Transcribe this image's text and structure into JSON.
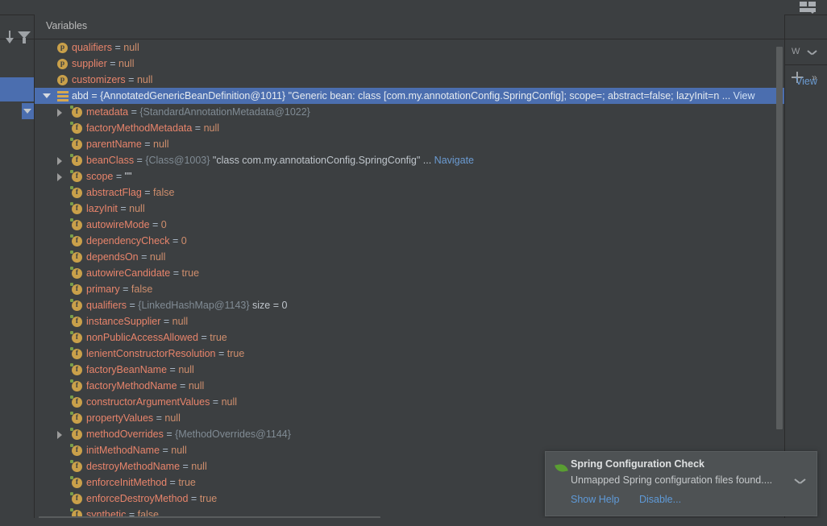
{
  "window": {
    "layout_icon": "window-layout-icon"
  },
  "toolbar_left": {
    "sort_icon": "sort-descending-icon",
    "filter_icon": "filter-funnel-icon"
  },
  "panel": {
    "title": "Variables"
  },
  "right_rail": {
    "watch_icon": "watch-variable-icon",
    "expand_icon": "chevron-down-icon",
    "add_icon": "plus-icon",
    "more_icon": "»",
    "view_label": "View"
  },
  "tree": {
    "rows": [
      {
        "indent": 0,
        "twisty": "none",
        "icon": "p",
        "name": "qualifiers",
        "eq": " = ",
        "value": "null",
        "value_kind": "null",
        "extra": "",
        "link": "",
        "selected": false
      },
      {
        "indent": 0,
        "twisty": "none",
        "icon": "p",
        "name": "supplier",
        "eq": " = ",
        "value": "null",
        "value_kind": "null",
        "extra": "",
        "link": "",
        "selected": false
      },
      {
        "indent": 0,
        "twisty": "none",
        "icon": "p",
        "name": "customizers",
        "eq": " = ",
        "value": "null",
        "value_kind": "null",
        "extra": "",
        "link": "",
        "selected": false
      },
      {
        "indent": 0,
        "twisty": "open",
        "icon": "stack",
        "name": "abd",
        "eq": " = ",
        "value": "{AnnotatedGenericBeanDefinition@1011}",
        "value_kind": "ref",
        "extra": " \"Generic bean: class [com.my.annotationConfig.SpringConfig]; scope=; abstract=false; lazyInit=n ...",
        "link": "View",
        "selected": true
      },
      {
        "indent": 1,
        "twisty": "closed",
        "icon": "f",
        "name": "metadata",
        "eq": " = ",
        "value": "{StandardAnnotationMetadata@1022}",
        "value_kind": "ref",
        "extra": "",
        "link": "",
        "selected": false
      },
      {
        "indent": 1,
        "twisty": "none",
        "icon": "f",
        "name": "factoryMethodMetadata",
        "eq": " = ",
        "value": "null",
        "value_kind": "null",
        "extra": "",
        "link": "",
        "selected": false
      },
      {
        "indent": 1,
        "twisty": "none",
        "icon": "f",
        "name": "parentName",
        "eq": " = ",
        "value": "null",
        "value_kind": "null",
        "extra": "",
        "link": "",
        "selected": false
      },
      {
        "indent": 1,
        "twisty": "closed",
        "icon": "f",
        "name": "beanClass",
        "eq": " = ",
        "value": "{Class@1003}",
        "value_kind": "ref",
        "extra": " \"class com.my.annotationConfig.SpringConfig\" ...",
        "link": "Navigate",
        "selected": false
      },
      {
        "indent": 1,
        "twisty": "closed",
        "icon": "f",
        "name": "scope",
        "eq": " = ",
        "value": "\"\"",
        "value_kind": "str",
        "extra": "",
        "link": "",
        "selected": false
      },
      {
        "indent": 1,
        "twisty": "none",
        "icon": "f",
        "name": "abstractFlag",
        "eq": " = ",
        "value": "false",
        "value_kind": "bool",
        "extra": "",
        "link": "",
        "selected": false
      },
      {
        "indent": 1,
        "twisty": "none",
        "icon": "f",
        "name": "lazyInit",
        "eq": " = ",
        "value": "null",
        "value_kind": "null",
        "extra": "",
        "link": "",
        "selected": false
      },
      {
        "indent": 1,
        "twisty": "none",
        "icon": "f",
        "name": "autowireMode",
        "eq": " = ",
        "value": "0",
        "value_kind": "num",
        "extra": "",
        "link": "",
        "selected": false
      },
      {
        "indent": 1,
        "twisty": "none",
        "icon": "f",
        "name": "dependencyCheck",
        "eq": " = ",
        "value": "0",
        "value_kind": "num",
        "extra": "",
        "link": "",
        "selected": false
      },
      {
        "indent": 1,
        "twisty": "none",
        "icon": "f",
        "name": "dependsOn",
        "eq": " = ",
        "value": "null",
        "value_kind": "null",
        "extra": "",
        "link": "",
        "selected": false
      },
      {
        "indent": 1,
        "twisty": "none",
        "icon": "f",
        "name": "autowireCandidate",
        "eq": " = ",
        "value": "true",
        "value_kind": "bool",
        "extra": "",
        "link": "",
        "selected": false
      },
      {
        "indent": 1,
        "twisty": "none",
        "icon": "f",
        "name": "primary",
        "eq": " = ",
        "value": "false",
        "value_kind": "bool",
        "extra": "",
        "link": "",
        "selected": false
      },
      {
        "indent": 1,
        "twisty": "none",
        "icon": "f",
        "name": "qualifiers",
        "eq": " = ",
        "value": "{LinkedHashMap@1143}",
        "value_kind": "ref",
        "extra": "  size = 0",
        "link": "",
        "selected": false
      },
      {
        "indent": 1,
        "twisty": "none",
        "icon": "f",
        "name": "instanceSupplier",
        "eq": " = ",
        "value": "null",
        "value_kind": "null",
        "extra": "",
        "link": "",
        "selected": false
      },
      {
        "indent": 1,
        "twisty": "none",
        "icon": "f",
        "name": "nonPublicAccessAllowed",
        "eq": " = ",
        "value": "true",
        "value_kind": "bool",
        "extra": "",
        "link": "",
        "selected": false
      },
      {
        "indent": 1,
        "twisty": "none",
        "icon": "f",
        "name": "lenientConstructorResolution",
        "eq": " = ",
        "value": "true",
        "value_kind": "bool",
        "extra": "",
        "link": "",
        "selected": false
      },
      {
        "indent": 1,
        "twisty": "none",
        "icon": "f",
        "name": "factoryBeanName",
        "eq": " = ",
        "value": "null",
        "value_kind": "null",
        "extra": "",
        "link": "",
        "selected": false
      },
      {
        "indent": 1,
        "twisty": "none",
        "icon": "f",
        "name": "factoryMethodName",
        "eq": " = ",
        "value": "null",
        "value_kind": "null",
        "extra": "",
        "link": "",
        "selected": false
      },
      {
        "indent": 1,
        "twisty": "none",
        "icon": "f",
        "name": "constructorArgumentValues",
        "eq": " = ",
        "value": "null",
        "value_kind": "null",
        "extra": "",
        "link": "",
        "selected": false
      },
      {
        "indent": 1,
        "twisty": "none",
        "icon": "f",
        "name": "propertyValues",
        "eq": " = ",
        "value": "null",
        "value_kind": "null",
        "extra": "",
        "link": "",
        "selected": false
      },
      {
        "indent": 1,
        "twisty": "closed",
        "icon": "f",
        "name": "methodOverrides",
        "eq": " = ",
        "value": "{MethodOverrides@1144}",
        "value_kind": "ref",
        "extra": "",
        "link": "",
        "selected": false
      },
      {
        "indent": 1,
        "twisty": "none",
        "icon": "f",
        "name": "initMethodName",
        "eq": " = ",
        "value": "null",
        "value_kind": "null",
        "extra": "",
        "link": "",
        "selected": false
      },
      {
        "indent": 1,
        "twisty": "none",
        "icon": "f",
        "name": "destroyMethodName",
        "eq": " = ",
        "value": "null",
        "value_kind": "null",
        "extra": "",
        "link": "",
        "selected": false
      },
      {
        "indent": 1,
        "twisty": "none",
        "icon": "f",
        "name": "enforceInitMethod",
        "eq": " = ",
        "value": "true",
        "value_kind": "bool",
        "extra": "",
        "link": "",
        "selected": false
      },
      {
        "indent": 1,
        "twisty": "none",
        "icon": "f",
        "name": "enforceDestroyMethod",
        "eq": " = ",
        "value": "true",
        "value_kind": "bool",
        "extra": "",
        "link": "",
        "selected": false
      },
      {
        "indent": 1,
        "twisty": "none",
        "icon": "f",
        "name": "synthetic",
        "eq": " = ",
        "value": "false",
        "value_kind": "bool",
        "extra": "",
        "link": "",
        "selected": false
      }
    ]
  },
  "notification": {
    "icon": "spring-leaf-icon",
    "title": "Spring Configuration Check",
    "message": "Unmapped Spring configuration files found....",
    "collapse_icon": "chevron-down-icon",
    "actions": [
      "Show Help",
      "Disable..."
    ]
  },
  "colors": {
    "selection": "#4b6eaf",
    "background": "#3c3f41",
    "name_fg": "#e8846b",
    "ref_fg": "#808b94",
    "link_fg": "#6b9bd2",
    "notif_bg": "#4e5254",
    "spring_green": "#5a9e32"
  }
}
